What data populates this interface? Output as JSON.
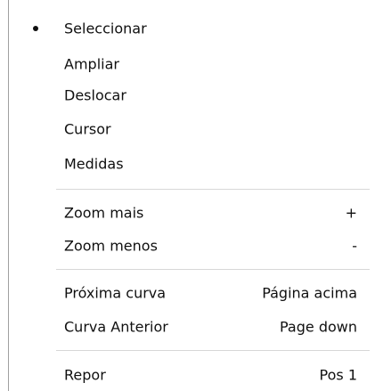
{
  "menu": {
    "groups": [
      {
        "items": [
          {
            "label": "Seleccionar",
            "shortcut": "",
            "selected": true
          },
          {
            "label": "Ampliar",
            "shortcut": ""
          },
          {
            "label": "Deslocar",
            "shortcut": ""
          },
          {
            "label": "Cursor",
            "shortcut": ""
          },
          {
            "label": "Medidas",
            "shortcut": ""
          }
        ]
      },
      {
        "items": [
          {
            "label": "Zoom mais",
            "shortcut": "+"
          },
          {
            "label": "Zoom menos",
            "shortcut": "-"
          }
        ]
      },
      {
        "items": [
          {
            "label": "Próxima curva",
            "shortcut": "Página acima"
          },
          {
            "label": "Curva Anterior",
            "shortcut": "Page down"
          }
        ]
      },
      {
        "items": [
          {
            "label": "Repor",
            "shortcut": "Pos 1"
          }
        ]
      }
    ]
  }
}
